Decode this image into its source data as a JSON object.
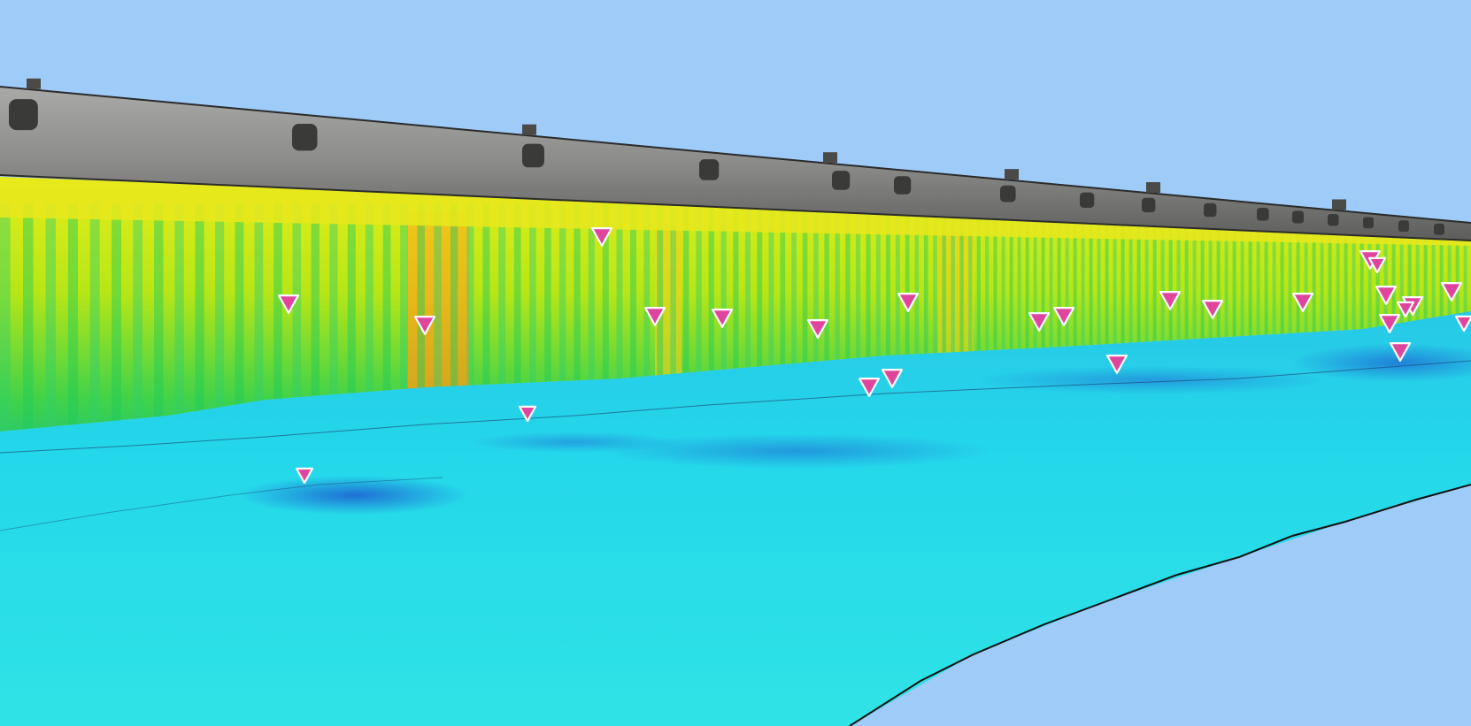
{
  "viewer": {
    "background_color": "#9ecbf8",
    "scene": "3d-point-cloud-quay-wall-survey",
    "palette": {
      "seabed_deep": "#1d6fd6",
      "seabed": "#22d6ec",
      "seabed_shallow": "#2fe6e8",
      "wall_low": "#1ec95a",
      "wall_mid": "#8fe014",
      "wall_high": "#f0ec10",
      "wall_hot": "#f0a818",
      "deck_concrete": "#8a8a8a"
    }
  },
  "markers": {
    "icon": "inverted-triangle-marker-icon",
    "fill_color": "#e0459e",
    "outline_color": "#ffffff",
    "count": 26
  }
}
